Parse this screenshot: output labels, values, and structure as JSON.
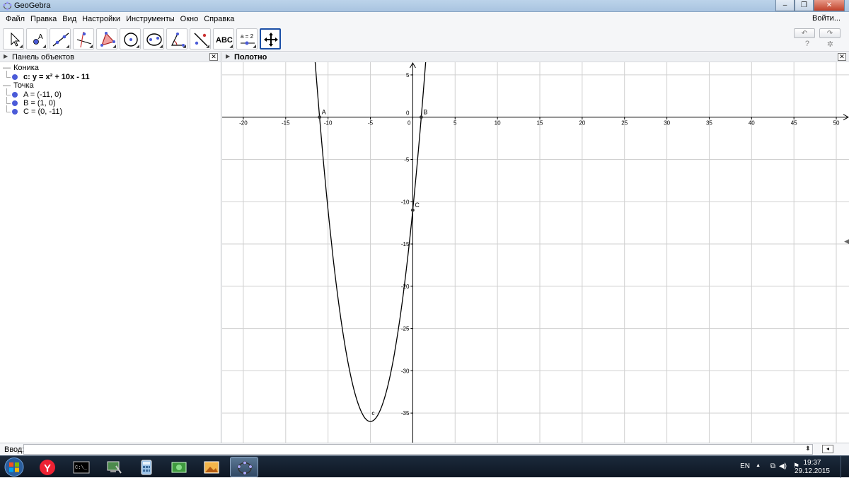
{
  "window": {
    "title": "GeoGebra"
  },
  "menu": {
    "items": [
      "Файл",
      "Правка",
      "Вид",
      "Настройки",
      "Инструменты",
      "Окно",
      "Справка"
    ],
    "login": "Войти..."
  },
  "toolbar": {
    "tools": [
      "move",
      "point",
      "line",
      "perpendicular",
      "polygon",
      "circle",
      "conic",
      "angle",
      "reflect",
      "text",
      "slider",
      "move-graphics"
    ],
    "text_tool_label": "ABC",
    "slider_tool_label": "a = 2",
    "help": "?"
  },
  "algebra": {
    "title": "Панель объектов",
    "groups": [
      {
        "name": "Коника",
        "items": [
          {
            "text": "c: y = x² + 10x - 11",
            "bold": true
          }
        ]
      },
      {
        "name": "Точка",
        "items": [
          {
            "text": "A = (-11, 0)",
            "bold": false
          },
          {
            "text": "B = (1, 0)",
            "bold": false
          },
          {
            "text": "C = (0, -11)",
            "bold": false
          }
        ]
      }
    ]
  },
  "graphics": {
    "title": "Полотно"
  },
  "chart_data": {
    "type": "line",
    "function": "y = x² + 10x - 11",
    "curve_label": "c",
    "xlim": [
      -22.5,
      51.5
    ],
    "ylim": [
      -38.5,
      6.5
    ],
    "x_ticks": [
      -20,
      -15,
      -10,
      -5,
      0,
      5,
      10,
      15,
      20,
      25,
      30,
      35,
      40,
      45,
      50
    ],
    "y_ticks": [
      5,
      0,
      -5,
      -10,
      -15,
      -20,
      -25,
      -30,
      -35
    ],
    "grid": true,
    "points": [
      {
        "name": "A",
        "x": -11,
        "y": 0
      },
      {
        "name": "B",
        "x": 1,
        "y": 0
      },
      {
        "name": "C",
        "x": 0,
        "y": -11
      }
    ],
    "colors": {
      "grid": "#d0d0d0",
      "axis": "#000000",
      "curve": "#000000",
      "point": "#333333"
    }
  },
  "input": {
    "label": "Ввод:",
    "value": ""
  },
  "taskbar": {
    "apps": [
      "yandex-browser",
      "command-prompt",
      "system-tool",
      "calculator",
      "money-app",
      "image-viewer",
      "geogebra"
    ],
    "language": "EN",
    "time": "19:37",
    "date": "29.12.2015"
  }
}
